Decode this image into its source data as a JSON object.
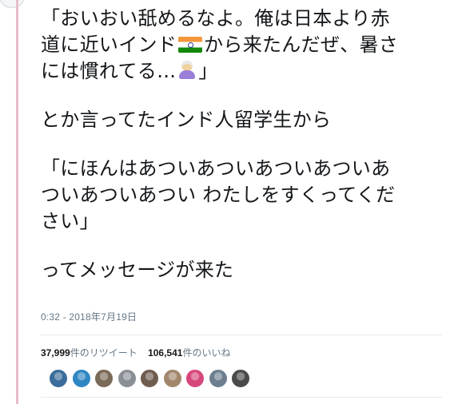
{
  "tweet": {
    "paragraph1": {
      "line1": "「おいおい舐めるなよ。俺は日本より赤",
      "line2_before_flag": "道に近いインド",
      "flag_icon": "india-flag-emoji",
      "line2_after_flag": "から来たんだぜ、暑さ",
      "line3_before_emoji": "には慣れてる…",
      "person_icon": "person-with-turban-emoji",
      "line3_after_emoji": "」"
    },
    "paragraph2": "とか言ってたインド人留学生から",
    "paragraph3": {
      "line1": "「にほんはあついあついあついあついあ",
      "line2": "ついあついあつい わたしをすくってくだ",
      "line3": "さい」"
    },
    "paragraph4": "ってメッセージが来た",
    "timestamp": "0:32 - 2018年7月19日",
    "stats": {
      "retweet_count": "37,999",
      "retweet_label": "件のリツイート",
      "like_count": "106,541",
      "like_label": "件のいいね"
    },
    "likers": {
      "colors": [
        "#3a6d9a",
        "#2f86c4",
        "#7a6a58",
        "#8a8f95",
        "#6e5c4f",
        "#a3876d",
        "#d6477c",
        "#6d7f8f",
        "#4a4a4a"
      ]
    },
    "colors": {
      "thread_line": "#e8bdca",
      "meta_text": "#657786"
    }
  }
}
